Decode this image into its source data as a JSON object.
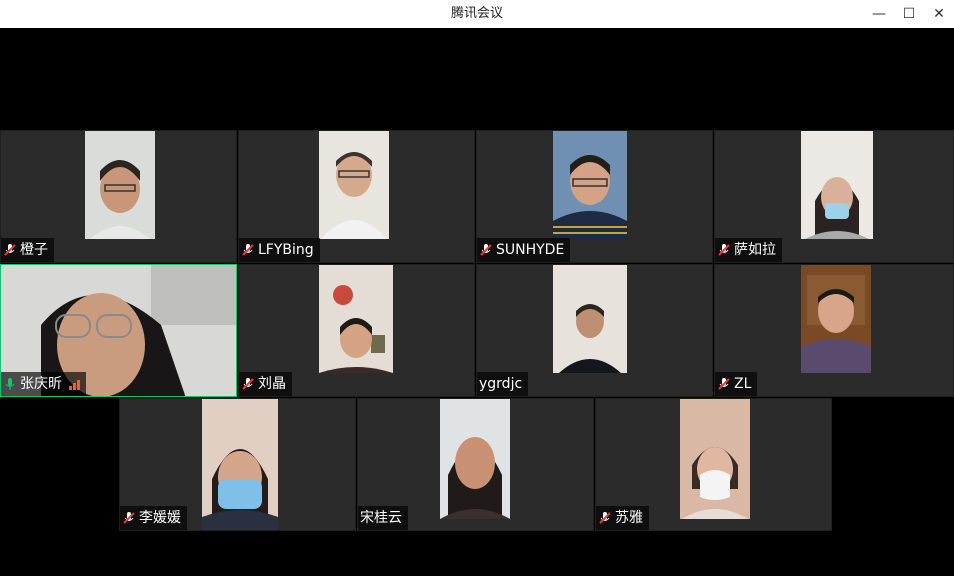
{
  "window": {
    "title": "腾讯会议",
    "minimize_glyph": "—",
    "maximize_glyph": "☐",
    "close_glyph": "✕"
  },
  "participants": [
    {
      "name": "橙子",
      "mic": "muted"
    },
    {
      "name": "LFYBing",
      "mic": "muted"
    },
    {
      "name": "SUNHYDE",
      "mic": "muted"
    },
    {
      "name": "萨如拉",
      "mic": "muted"
    },
    {
      "name": "张庆昕",
      "mic": "active",
      "speaking": true
    },
    {
      "name": "刘晶",
      "mic": "muted"
    },
    {
      "name": "ygrdjc",
      "mic": "none"
    },
    {
      "name": "ZL",
      "mic": "muted"
    },
    {
      "name": "李媛媛",
      "mic": "muted"
    },
    {
      "name": "宋桂云",
      "mic": "none"
    },
    {
      "name": "苏雅",
      "mic": "muted"
    }
  ],
  "icons": {
    "muted_mic": "mic-muted-icon",
    "active_mic": "mic-active-icon",
    "signal": "signal-strength-icon"
  },
  "colors": {
    "speaking_border": "#19c36b",
    "muted_mic": "#e03a3a",
    "active_mic": "#19c36b",
    "tile_bg": "#2b2b2b"
  }
}
